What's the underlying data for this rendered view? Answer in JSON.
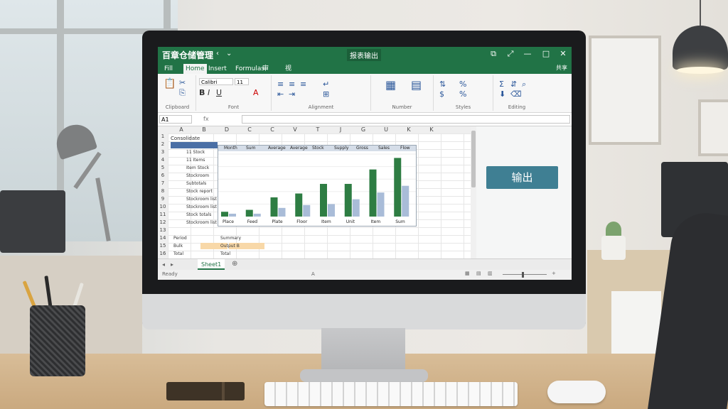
{
  "window": {
    "app_title": "百章仓储管理",
    "nav_back": "‹",
    "nav_dropdown": "⌄",
    "file_name": "报表输出",
    "controls": [
      "⧉",
      "⤢",
      "—",
      "□",
      "✕"
    ]
  },
  "ribbon": {
    "tabs": [
      "Fill",
      "Home",
      "Insert",
      "Formulas",
      "审",
      "视"
    ],
    "share_label": "共享",
    "groups": [
      {
        "label": "Clipboard"
      },
      {
        "label": "Font"
      },
      {
        "label": "Alignment"
      },
      {
        "label": "Number"
      },
      {
        "label": "Styles"
      },
      {
        "label": "Editing"
      }
    ],
    "font_name": "Calibri",
    "font_size": "11"
  },
  "formula_bar": {
    "name_box": "A1",
    "fx_label": "fx",
    "formula": ""
  },
  "sheet": {
    "columns": [
      "A",
      "B",
      "D",
      "C",
      "C",
      "V",
      "T",
      "J",
      "G",
      "U",
      "K",
      "K"
    ],
    "rows": [
      "1",
      "2",
      "3",
      "4",
      "5",
      "6",
      "7",
      "8",
      "9",
      "10",
      "11",
      "12",
      "13",
      "14",
      "15",
      "16"
    ],
    "title_cell": "Consolidate",
    "list_items": [
      "11 Stock",
      "11 Items",
      "Item Stock",
      "Stockroom",
      "Subtotals",
      "Stock report",
      "Stockroom list",
      "Stockroom list",
      "Stock totals",
      "Stockroom list"
    ],
    "footer_labels": [
      "Period",
      "Bulk",
      "Total"
    ],
    "footer_values": [
      "Summary",
      "Output B",
      "Total"
    ],
    "chart_headers": [
      "Month",
      "Sum",
      "Average",
      "Average",
      "Stock",
      "Supply",
      "Gross",
      "Sales",
      "Flow"
    ]
  },
  "chart_data": {
    "type": "bar",
    "categories": [
      "Place",
      "Feed",
      "Plate",
      "Floor",
      "Item",
      "Unit",
      "Item",
      "Sum"
    ],
    "series": [
      {
        "values": [
          0.5,
          0.7,
          2.0,
          2.4,
          3.4,
          3.4,
          4.9,
          6.1
        ]
      },
      {
        "values": [
          0.3,
          0.3,
          0.9,
          1.2,
          1.3,
          1.8,
          2.5,
          3.2
        ]
      }
    ],
    "series_colors": [
      "#2e7d43",
      "#a9bcd8"
    ],
    "ylim": [
      0,
      6.5
    ],
    "grid": true,
    "legend": "none"
  },
  "side_panel": {
    "export_button": "输出"
  },
  "sheet_tabs": {
    "active": "Sheet1",
    "add": "⊕"
  },
  "status": {
    "ready": "Ready",
    "center": "A"
  }
}
